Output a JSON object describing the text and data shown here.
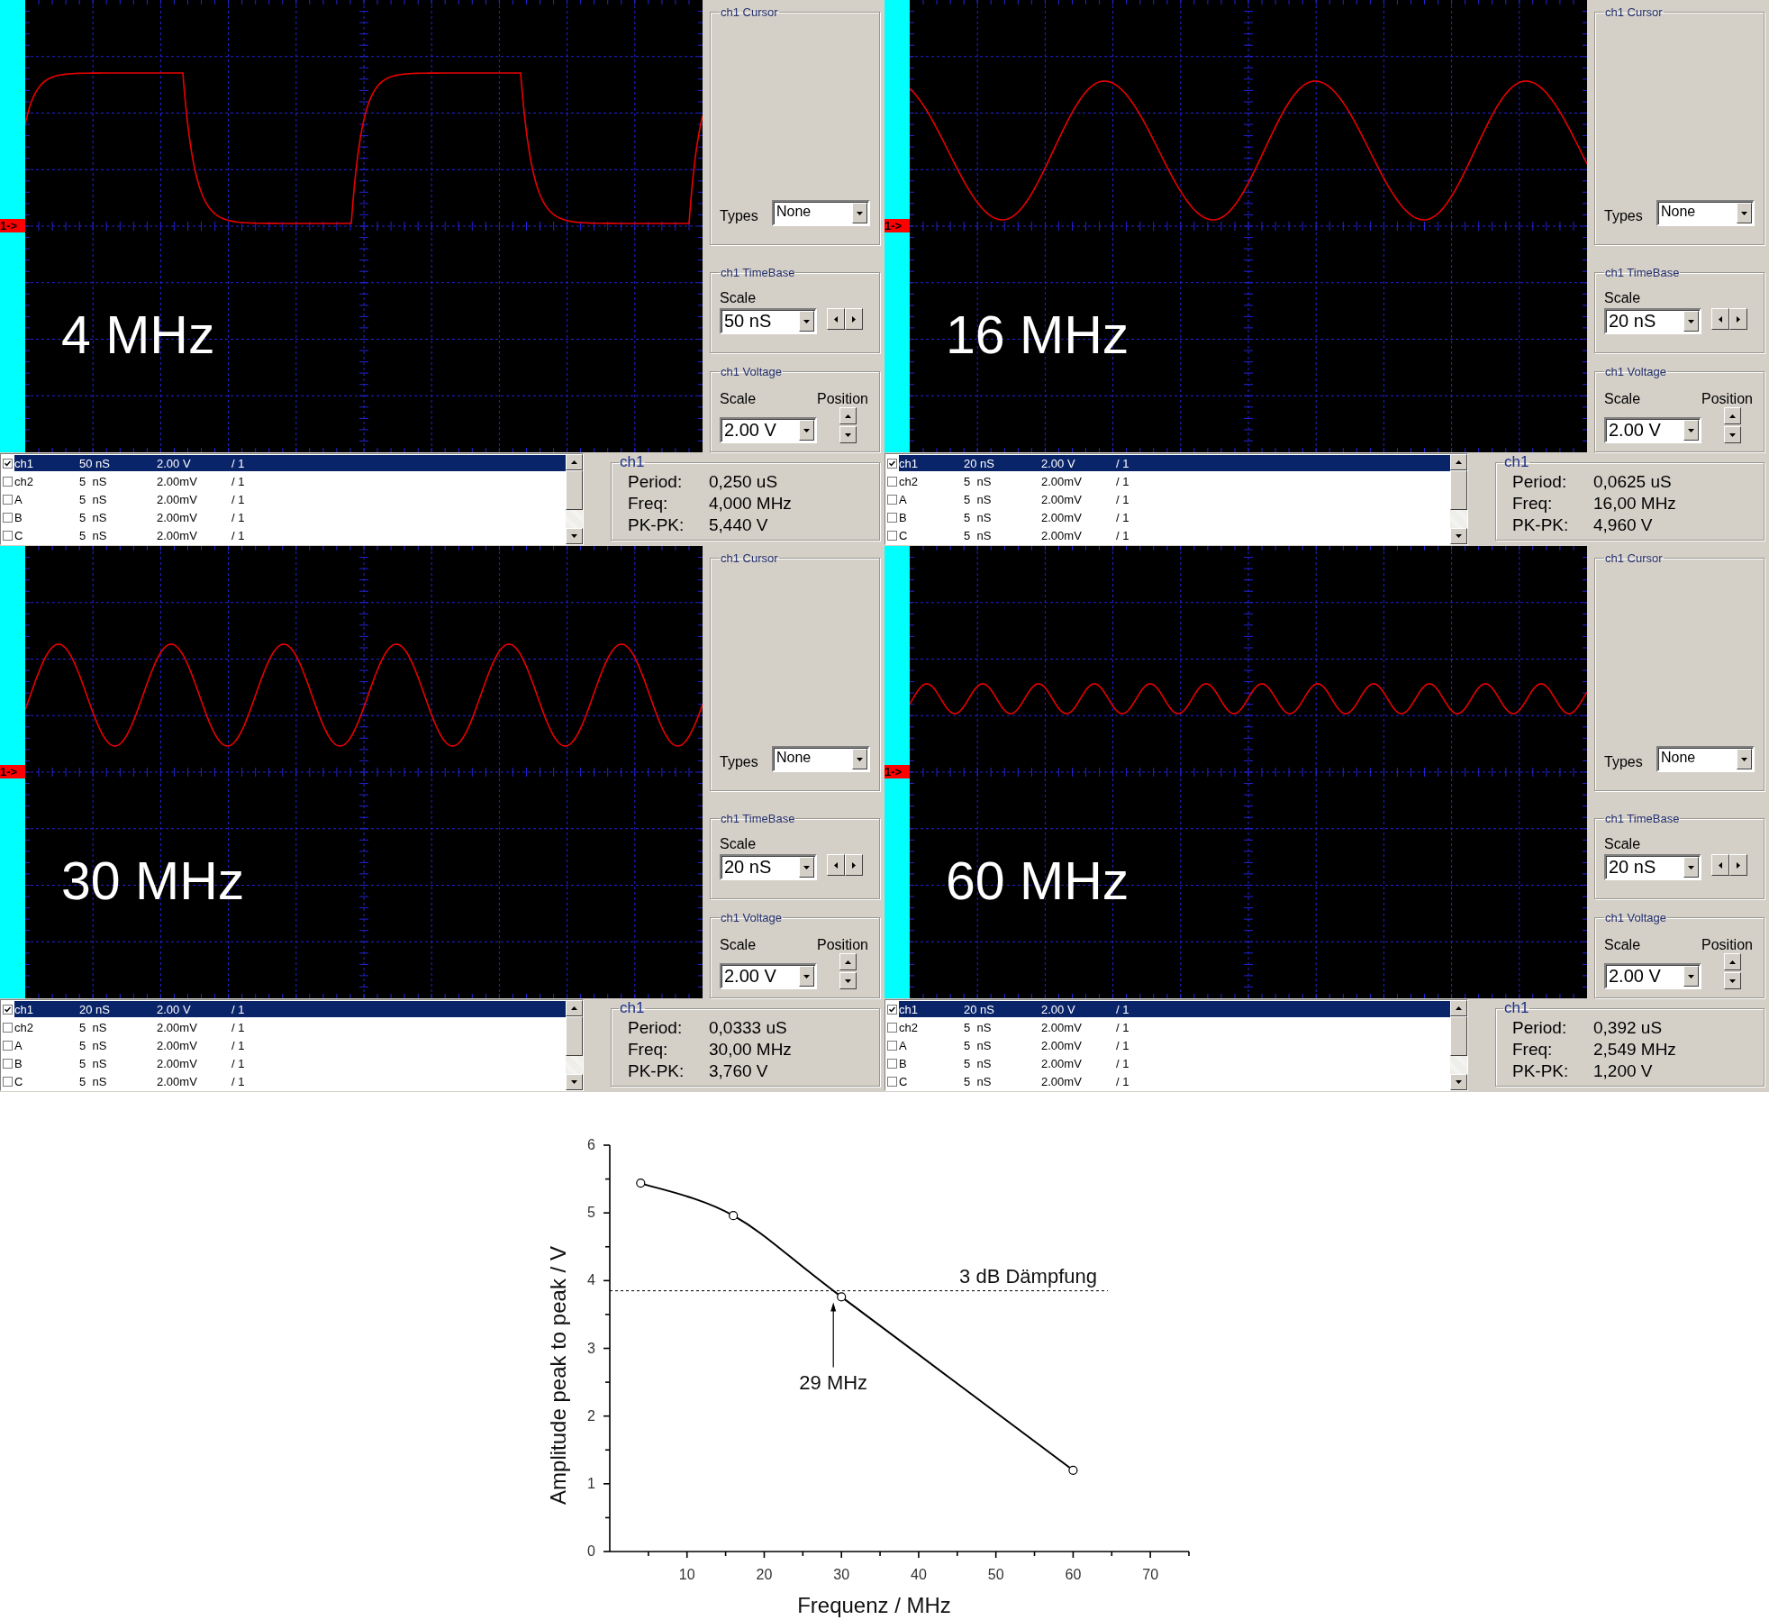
{
  "scope_panels": [
    {
      "frequency_label": "4 MHz",
      "ground_marker": "1->",
      "trace": {
        "kind": "square"
      },
      "cursor": {
        "title": "ch1 Cursor",
        "types_label": "Types",
        "types_value": "None"
      },
      "timebase": {
        "title": "ch1 TimeBase",
        "scale_label": "Scale",
        "scale_value": "50 nS"
      },
      "voltage": {
        "title": "ch1 Voltage",
        "scale_label": "Scale",
        "position_label": "Position",
        "scale_value": "2.00 V"
      },
      "channels": [
        {
          "name": "ch1",
          "timebase": "50 nS",
          "volts": "2.00 V",
          "ratio": "/ 1",
          "checked": true,
          "selected": true
        },
        {
          "name": "ch2",
          "timebase": "5  nS",
          "volts": "2.00mV",
          "ratio": "/ 1",
          "checked": false,
          "selected": false
        },
        {
          "name": "A",
          "timebase": "5  nS",
          "volts": "2.00mV",
          "ratio": "/ 1",
          "checked": false,
          "selected": false
        },
        {
          "name": "B",
          "timebase": "5  nS",
          "volts": "2.00mV",
          "ratio": "/ 1",
          "checked": false,
          "selected": false
        },
        {
          "name": "C",
          "timebase": "5  nS",
          "volts": "2.00mV",
          "ratio": "/ 1",
          "checked": false,
          "selected": false
        }
      ],
      "measurement": {
        "title": "ch1",
        "rows": [
          {
            "label": "Period:",
            "value": "0,250 uS"
          },
          {
            "label": "Freq:",
            "value": "4,000 MHz"
          },
          {
            "label": "PK-PK:",
            "value": "5,440 V"
          }
        ]
      }
    },
    {
      "frequency_label": "16 MHz",
      "ground_marker": "1->",
      "trace": {
        "kind": "skewed"
      },
      "cursor": {
        "title": "ch1 Cursor",
        "types_label": "Types",
        "types_value": "None"
      },
      "timebase": {
        "title": "ch1 TimeBase",
        "scale_label": "Scale",
        "scale_value": "20 nS"
      },
      "voltage": {
        "title": "ch1 Voltage",
        "scale_label": "Scale",
        "position_label": "Position",
        "scale_value": "2.00 V"
      },
      "channels": [
        {
          "name": "ch1",
          "timebase": "20 nS",
          "volts": "2.00 V",
          "ratio": "/ 1",
          "checked": true,
          "selected": true
        },
        {
          "name": "ch2",
          "timebase": "5  nS",
          "volts": "2.00mV",
          "ratio": "/ 1",
          "checked": false,
          "selected": false
        },
        {
          "name": "A",
          "timebase": "5  nS",
          "volts": "2.00mV",
          "ratio": "/ 1",
          "checked": false,
          "selected": false
        },
        {
          "name": "B",
          "timebase": "5  nS",
          "volts": "2.00mV",
          "ratio": "/ 1",
          "checked": false,
          "selected": false
        },
        {
          "name": "C",
          "timebase": "5  nS",
          "volts": "2.00mV",
          "ratio": "/ 1",
          "checked": false,
          "selected": false
        }
      ],
      "measurement": {
        "title": "ch1",
        "rows": [
          {
            "label": "Period:",
            "value": "0,0625 uS"
          },
          {
            "label": "Freq:",
            "value": "16,00 MHz"
          },
          {
            "label": "PK-PK:",
            "value": "4,960 V"
          }
        ]
      }
    },
    {
      "frequency_label": "30 MHz",
      "ground_marker": "1->",
      "trace": {
        "kind": "sine"
      },
      "cursor": {
        "title": "ch1 Cursor",
        "types_label": "Types",
        "types_value": "None"
      },
      "timebase": {
        "title": "ch1 TimeBase",
        "scale_label": "Scale",
        "scale_value": "20 nS"
      },
      "voltage": {
        "title": "ch1 Voltage",
        "scale_label": "Scale",
        "position_label": "Position",
        "scale_value": "2.00 V"
      },
      "channels": [
        {
          "name": "ch1",
          "timebase": "20 nS",
          "volts": "2.00 V",
          "ratio": "/ 1",
          "checked": true,
          "selected": true
        },
        {
          "name": "ch2",
          "timebase": "5  nS",
          "volts": "2.00mV",
          "ratio": "/ 1",
          "checked": false,
          "selected": false
        },
        {
          "name": "A",
          "timebase": "5  nS",
          "volts": "2.00mV",
          "ratio": "/ 1",
          "checked": false,
          "selected": false
        },
        {
          "name": "B",
          "timebase": "5  nS",
          "volts": "2.00mV",
          "ratio": "/ 1",
          "checked": false,
          "selected": false
        },
        {
          "name": "C",
          "timebase": "5  nS",
          "volts": "2.00mV",
          "ratio": "/ 1",
          "checked": false,
          "selected": false
        }
      ],
      "measurement": {
        "title": "ch1",
        "rows": [
          {
            "label": "Period:",
            "value": "0,0333 uS"
          },
          {
            "label": "Freq:",
            "value": "30,00 MHz"
          },
          {
            "label": "PK-PK:",
            "value": "3,760 V"
          }
        ]
      }
    },
    {
      "frequency_label": "60 MHz",
      "ground_marker": "1->",
      "trace": {
        "kind": "ripple"
      },
      "cursor": {
        "title": "ch1 Cursor",
        "types_label": "Types",
        "types_value": "None"
      },
      "timebase": {
        "title": "ch1 TimeBase",
        "scale_label": "Scale",
        "scale_value": "20 nS"
      },
      "voltage": {
        "title": "ch1 Voltage",
        "scale_label": "Scale",
        "position_label": "Position",
        "scale_value": "2.00 V"
      },
      "channels": [
        {
          "name": "ch1",
          "timebase": "20 nS",
          "volts": "2.00 V",
          "ratio": "/ 1",
          "checked": true,
          "selected": true
        },
        {
          "name": "ch2",
          "timebase": "5  nS",
          "volts": "2.00mV",
          "ratio": "/ 1",
          "checked": false,
          "selected": false
        },
        {
          "name": "A",
          "timebase": "5  nS",
          "volts": "2.00mV",
          "ratio": "/ 1",
          "checked": false,
          "selected": false
        },
        {
          "name": "B",
          "timebase": "5  nS",
          "volts": "2.00mV",
          "ratio": "/ 1",
          "checked": false,
          "selected": false
        },
        {
          "name": "C",
          "timebase": "5  nS",
          "volts": "2.00mV",
          "ratio": "/ 1",
          "checked": false,
          "selected": false
        }
      ],
      "measurement": {
        "title": "ch1",
        "rows": [
          {
            "label": "Period:",
            "value": "0,392 uS"
          },
          {
            "label": "Freq:",
            "value": "2,549 MHz"
          },
          {
            "label": "PK-PK:",
            "value": "1,200 V"
          }
        ]
      }
    }
  ],
  "frequency_plot": {
    "chart_data": {
      "type": "line",
      "xlabel": "Frequenz / MHz",
      "ylabel": "Amplitude peak to peak / V",
      "x": [
        4,
        16,
        30,
        60
      ],
      "values": [
        5.44,
        4.96,
        3.76,
        1.2
      ],
      "marker": "circle",
      "xlim": [
        0,
        75
      ],
      "ylim": [
        0,
        6
      ],
      "xticks": [
        10,
        20,
        30,
        40,
        50,
        60,
        70
      ],
      "yticks": [
        0,
        1,
        2,
        3,
        4,
        5,
        6
      ],
      "ref_lines": [
        {
          "axis": "y",
          "value": 3.85,
          "label": "3 dB Dämpfung"
        }
      ],
      "annotations": [
        "29 MHz"
      ]
    }
  }
}
